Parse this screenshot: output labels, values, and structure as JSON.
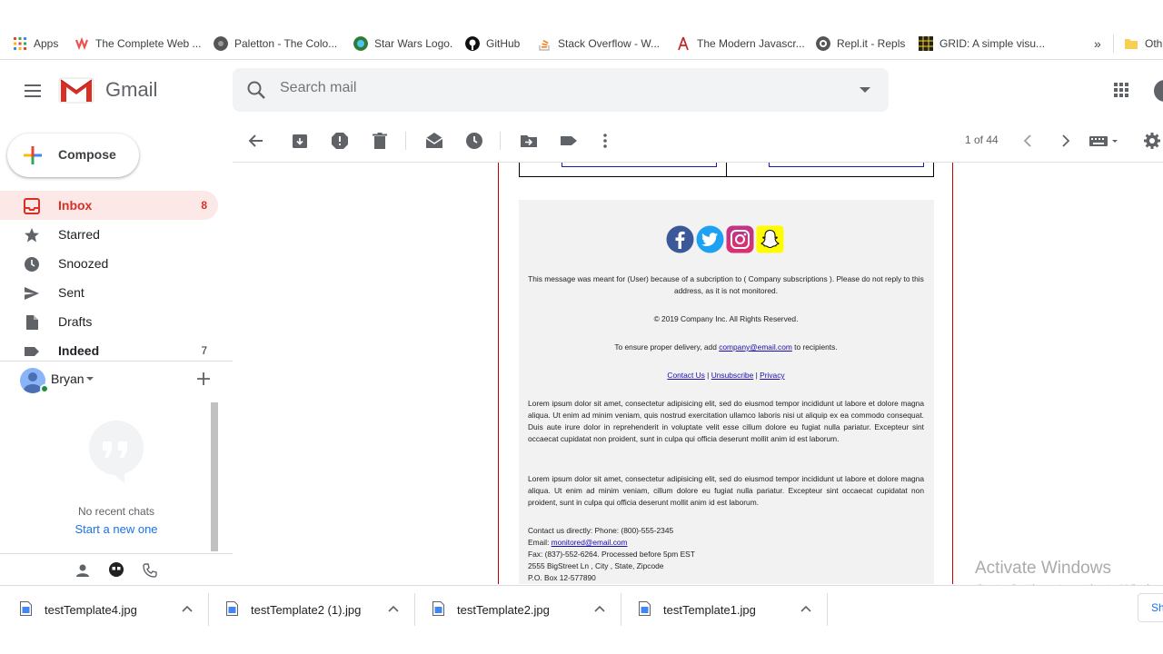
{
  "bookmarks": [
    {
      "label": "Apps",
      "icon": "apps-grid-icon",
      "color": "#e8453c"
    },
    {
      "label": "The Complete Web ...",
      "icon": "udemy-icon",
      "color": "#ec5252"
    },
    {
      "label": "Paletton - The Colo...",
      "icon": "paletton-icon",
      "color": "#555555"
    },
    {
      "label": "Star Wars Logo.",
      "icon": "wikipedia-icon",
      "color": "#2e7d32"
    },
    {
      "label": "GitHub",
      "icon": "github-icon",
      "color": "#111111"
    },
    {
      "label": "Stack Overflow - W...",
      "icon": "stackoverflow-icon",
      "color": "#f48024"
    },
    {
      "label": "The Modern Javascr...",
      "icon": "javascript-icon",
      "color": "#c62828"
    },
    {
      "label": "Repl.it - Repls",
      "icon": "replit-icon",
      "color": "#444444"
    },
    {
      "label": "GRID: A simple visu...",
      "icon": "grid-icon",
      "color": "#222222"
    },
    {
      "label": "»",
      "icon": "more-icon",
      "color": "#5f6368"
    },
    {
      "label": "Oth",
      "icon": "folder-icon",
      "color": "#f9cf52"
    }
  ],
  "header": {
    "app_name": "Gmail",
    "search_placeholder": "Search mail"
  },
  "sidebar": {
    "compose_label": "Compose",
    "items": [
      {
        "label": "Inbox",
        "count": "8",
        "icon": "inbox-icon"
      },
      {
        "label": "Starred",
        "count": "",
        "icon": "star-icon"
      },
      {
        "label": "Snoozed",
        "count": "",
        "icon": "clock-icon"
      },
      {
        "label": "Sent",
        "count": "",
        "icon": "send-icon"
      },
      {
        "label": "Drafts",
        "count": "",
        "icon": "draft-icon"
      },
      {
        "label": "Indeed",
        "count": "7",
        "icon": "label-icon"
      }
    ],
    "user_name": "Bryan",
    "no_chats": "No recent chats",
    "start_new": "Start a new one"
  },
  "toolbar": {
    "pager": "1 of 44"
  },
  "email": {
    "footer_notice": "This message was meant for (User) because of a subcription to ( Company subscriptions ). Please do not reply to this address, as it is not monitored.",
    "copyright": "© 2019 Company Inc. All Rights Reserved.",
    "delivery_prefix": "To ensure proper delivery, add ",
    "delivery_email": "company@email.com",
    "delivery_suffix": " to recipients.",
    "link_contact": "Contact Us",
    "link_unsubscribe": "Unsubscribe",
    "link_privacy": "Privacy",
    "link_sep": " | ",
    "lorem1": "Lorem ipsum dolor sit amet, consectetur adipisicing elit, sed do eiusmod tempor incididunt ut labore et dolore magna aliqua. Ut enim ad minim veniam, quis nostrud exercitation ullamco laboris nisi ut aliquip ex ea commodo consequat. Duis aute irure dolor in reprehenderit in voluptate velit esse cillum dolore eu fugiat nulla pariatur. Excepteur sint occaecat cupidatat non proident, sunt in culpa qui officia deserunt mollit anim id est laborum.",
    "lorem2": "Lorem ipsum dolor sit amet, consectetur adipisicing elit, sed do eiusmod tempor incididunt ut labore et dolore magna aliqua. Ut enim ad minim veniam, cillum dolore eu fugiat nulla pariatur. Excepteur sint occaecat cupidatat non proident, sunt in culpa qui officia deserunt mollit anim id est laborum.",
    "contact_line": "Contact us directly: Phone: (800)-555-2345",
    "email_prefix": "Email: ",
    "email_value": "monitored@email.com",
    "fax_line": "Fax: (837)-552-6264. Processed before 5pm EST",
    "address_line": "2555 BigStreet Ln , City , State, Zipcode",
    "po_line": "P.O. Box 12-577890"
  },
  "watermark": {
    "title": "Activate Windows",
    "subtitle": "Go to Settings to activate Windows."
  },
  "downloads": {
    "items": [
      "testTemplate4.jpg",
      "testTemplate2 (1).jpg",
      "testTemplate2.jpg",
      "testTemplate1.jpg"
    ],
    "show_all": "Sh"
  }
}
